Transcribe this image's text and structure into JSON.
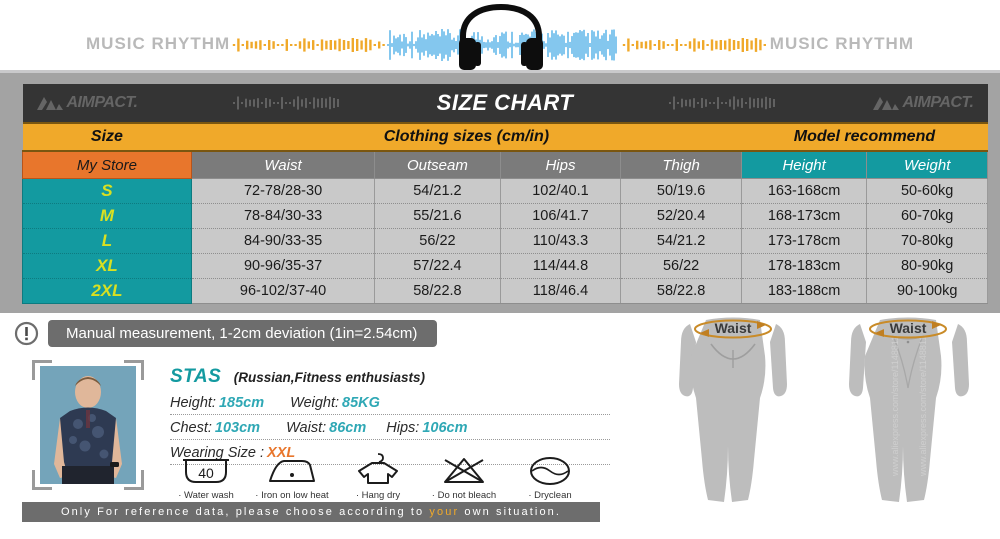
{
  "banner": {
    "left_text": "MUSIC RHYTHM",
    "right_text": "MUSIC RHYTHM",
    "headphone_icon": "headphone-icon",
    "waveform_icon": "audio-waveform"
  },
  "chart": {
    "title": "SIZE CHART",
    "brand": "AIMPACT.",
    "brand_left": "AIMPACT.",
    "brand_right": "AIMPACT.",
    "band": {
      "size": "Size",
      "clothing": "Clothing sizes  (cm/in)",
      "model": "Model recommend"
    },
    "headers": {
      "store": "My Store",
      "waist": "Waist",
      "outseam": "Outseam",
      "hips": "Hips",
      "thigh": "Thigh",
      "height": "Height",
      "weight": "Weight"
    },
    "rows": [
      {
        "size": "S",
        "waist": "72-78/28-30",
        "outseam": "54/21.2",
        "hips": "102/40.1",
        "thigh": "50/19.6",
        "height": "163-168cm",
        "weight": "50-60kg"
      },
      {
        "size": "M",
        "waist": "78-84/30-33",
        "outseam": "55/21.6",
        "hips": "106/41.7",
        "thigh": "52/20.4",
        "height": "168-173cm",
        "weight": "60-70kg"
      },
      {
        "size": "L",
        "waist": "84-90/33-35",
        "outseam": "56/22",
        "hips": "110/43.3",
        "thigh": "54/21.2",
        "height": "173-178cm",
        "weight": "70-80kg"
      },
      {
        "size": "XL",
        "waist": "90-96/35-37",
        "outseam": "57/22.4",
        "hips": "114/44.8",
        "thigh": "56/22",
        "height": "178-183cm",
        "weight": "80-90kg"
      },
      {
        "size": "2XL",
        "waist": "96-102/37-40",
        "outseam": "58/22.8",
        "hips": "118/46.4",
        "thigh": "58/22.8",
        "height": "183-188cm",
        "weight": "90-100kg"
      }
    ]
  },
  "note": {
    "icon": "warning-icon",
    "text": "Manual measurement, 1-2cm deviation (1in=2.54cm)"
  },
  "model": {
    "photo_alt": "model-photo",
    "name": "STAS",
    "description": "(Russian,Fitness enthusiasts)",
    "height_label": "Height:",
    "height_value": "185cm",
    "weight_label": "Weight:",
    "weight_value": "85KG",
    "chest_label": "Chest:",
    "chest_value": "103cm",
    "waist_label": "Waist:",
    "waist_value": "86cm",
    "hips_label": "Hips:",
    "hips_value": "106cm",
    "wearing_label": "Wearing Size :",
    "wearing_value": "XXL"
  },
  "care_instructions": [
    {
      "icon": "water-wash-icon",
      "label": "· Water wash",
      "temp": "40"
    },
    {
      "icon": "iron-low-heat-icon",
      "label": "· Iron on low heat",
      "temp": ""
    },
    {
      "icon": "hang-dry-icon",
      "label": "· Hang dry",
      "temp": ""
    },
    {
      "icon": "do-not-bleach-icon",
      "label": "· Do not bleach",
      "temp": ""
    },
    {
      "icon": "dryclean-icon",
      "label": "· Dryclean",
      "temp": ""
    }
  ],
  "figures": {
    "back_waist_label": "Waist",
    "front_waist_label": "Waist",
    "watermark": "www.aliexpress.com/store/1148811"
  },
  "footer": {
    "text_before": "Only For reference data, please choose according to ",
    "highlight": "your",
    "text_after": " own situation."
  },
  "colors": {
    "orange_band": "#f0a92a",
    "orange_store": "#e8762c",
    "teal": "#139aa0",
    "dark": "#343434",
    "gray_frame": "#a3a3a3",
    "cell_gray": "#c9c9c9",
    "size_yellow": "#d9e021"
  }
}
